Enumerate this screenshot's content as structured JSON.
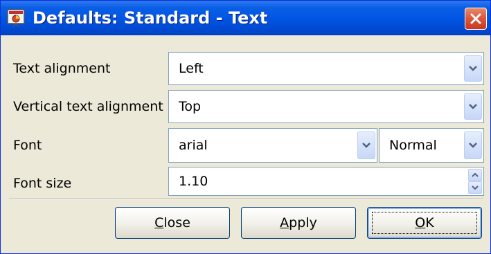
{
  "dialog": {
    "title": "Defaults: Standard - Text",
    "app_icon": "presentation-app-icon",
    "close_icon": "close-x-icon"
  },
  "rows": [
    {
      "label": "Text alignment",
      "value": "Left"
    },
    {
      "label": "Vertical text alignment",
      "value": "Top"
    },
    {
      "label": "Font",
      "value": "arial",
      "style_value": "Normal"
    },
    {
      "label": "Font size",
      "value": "1.10"
    }
  ],
  "buttons": {
    "close": {
      "mnemonic": "C",
      "rest": "lose"
    },
    "apply": {
      "mnemonic": "A",
      "rest": "pply"
    },
    "ok": {
      "mnemonic": "O",
      "rest": "K"
    }
  },
  "colors": {
    "title_bar": "#0054e3",
    "dialog_bg": "#ece9d8",
    "close_button": "#e0593c"
  }
}
